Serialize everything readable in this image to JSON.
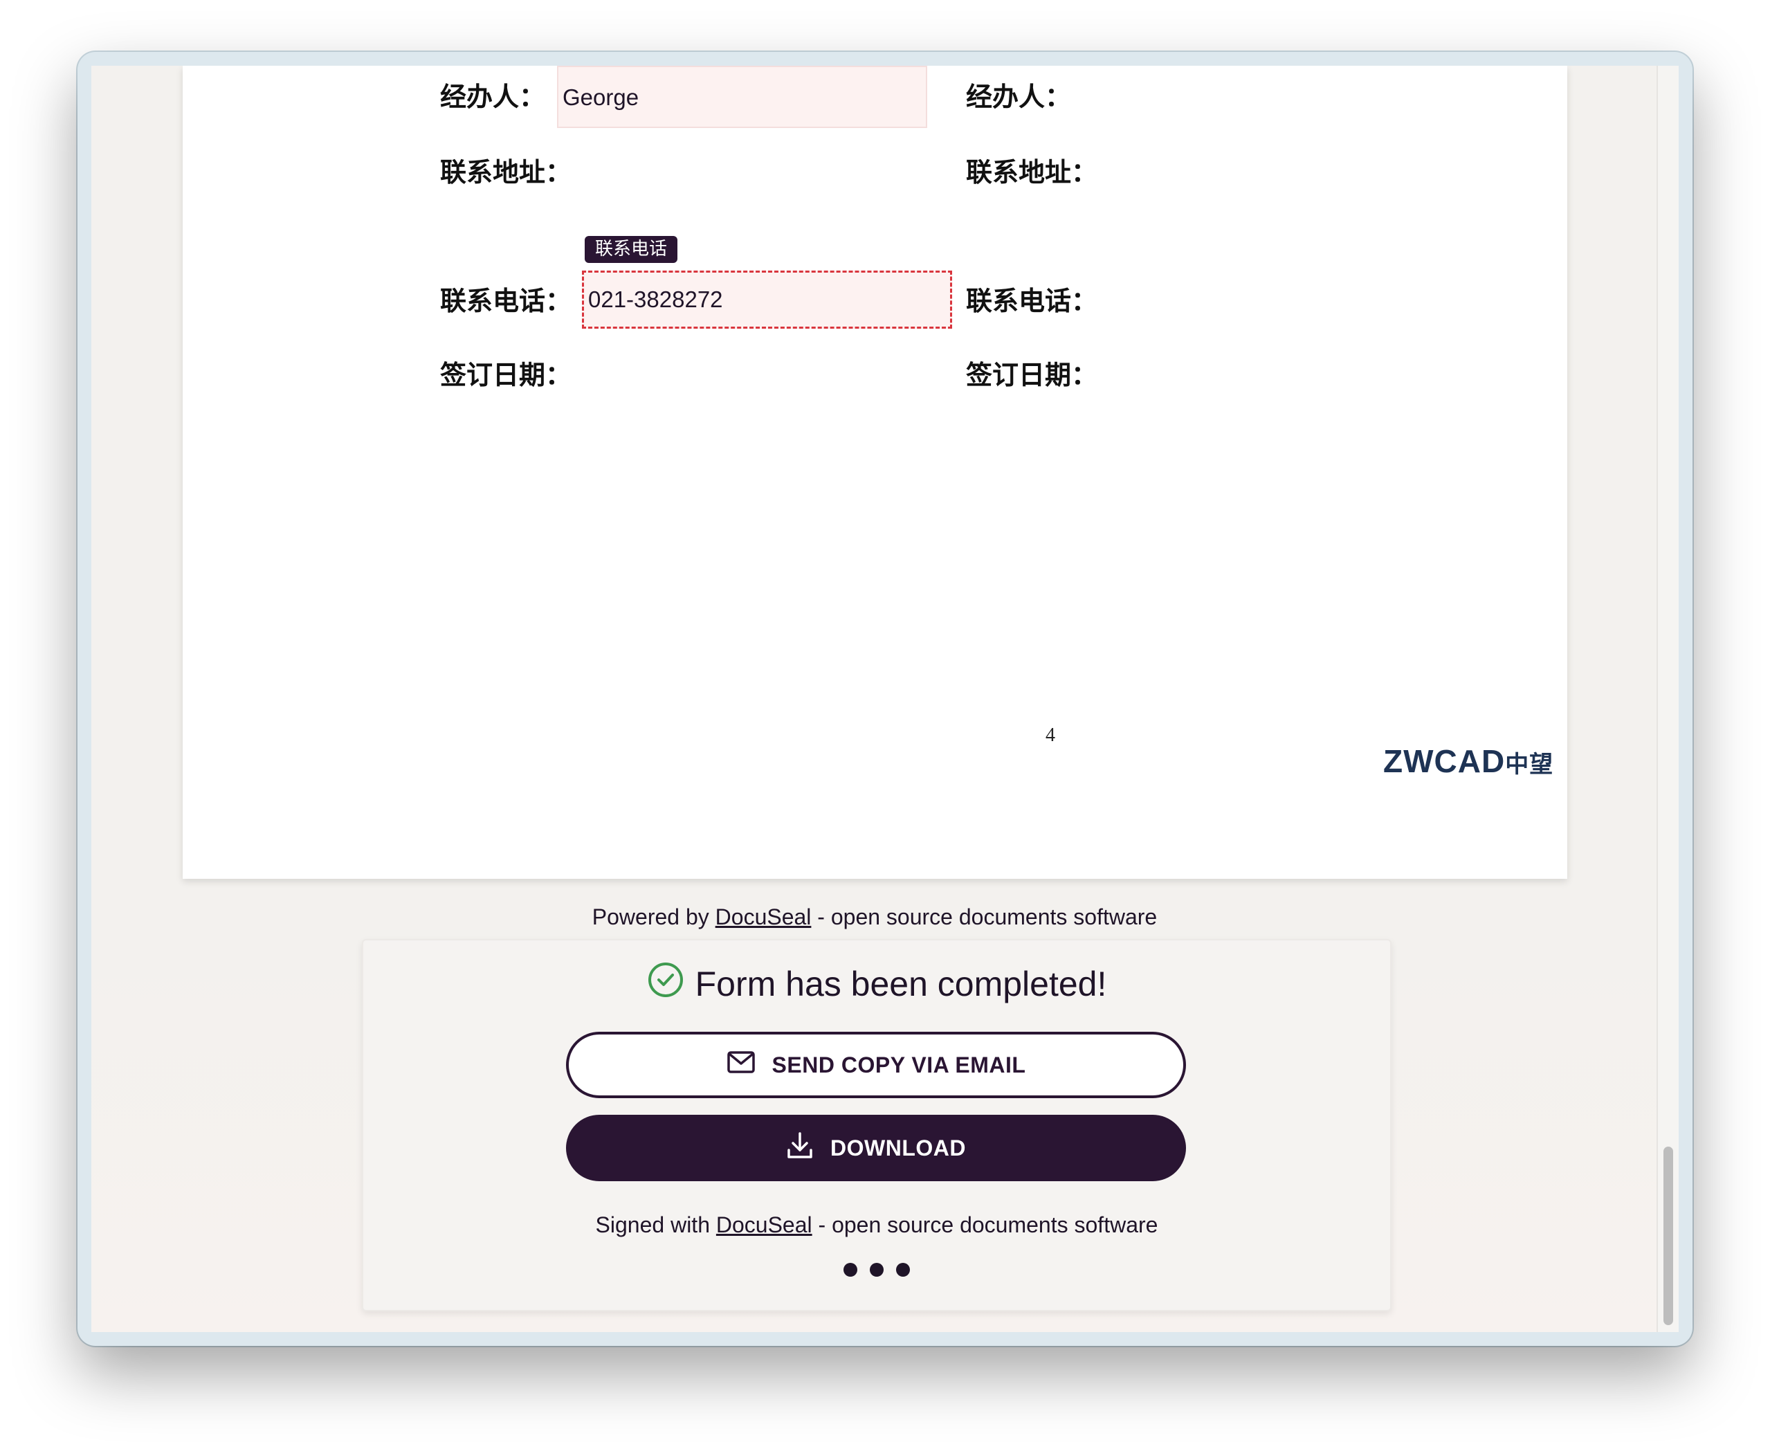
{
  "document": {
    "left_column": {
      "handler_label": "经办人：",
      "address_label": "联系地址：",
      "phone_label": "联系电话：",
      "date_label": "签订日期："
    },
    "right_column": {
      "handler_label": "经办人：",
      "address_label": "联系地址：",
      "phone_label": "联系电话：",
      "date_label": "签订日期："
    },
    "fields": {
      "handler_value": "George",
      "phone_tag": "联系电话",
      "phone_value": "021-3828272"
    },
    "page_number": "4",
    "logo_text": "ZWCAD",
    "logo_cn": "中望"
  },
  "footer": {
    "powered_prefix": "Powered by ",
    "powered_link": "DocuSeal",
    "powered_suffix": " - open source documents software"
  },
  "completion": {
    "title": "Form has been completed!",
    "send_copy_label": "SEND COPY VIA EMAIL",
    "download_label": "DOWNLOAD",
    "signed_prefix": "Signed with ",
    "signed_link": "DocuSeal",
    "signed_suffix": " - open source documents software",
    "check_icon": "check-circle-icon",
    "email_icon": "envelope-icon",
    "download_icon": "download-icon",
    "more_icon": "more-dots-icon"
  },
  "colors": {
    "brand_dark": "#2a1533",
    "success_green": "#3e9a4f",
    "field_bg": "#fdf2f1",
    "active_border": "#d9363e"
  }
}
